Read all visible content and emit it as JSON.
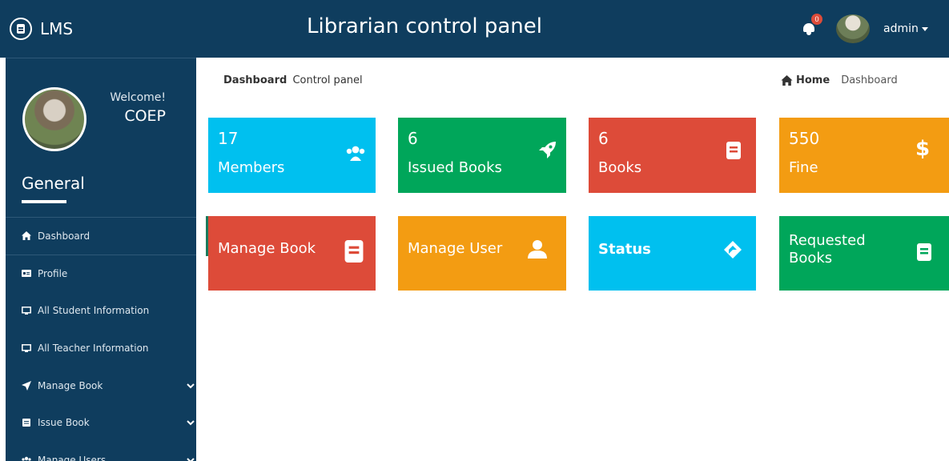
{
  "header": {
    "brand": "LMS",
    "title": "Librarian control panel",
    "notification_count": "0",
    "user": "admin"
  },
  "sidebar": {
    "welcome": "Welcome!",
    "username": "COEP",
    "section": "General",
    "items": [
      {
        "label": "Dashboard",
        "icon": "home-icon"
      },
      {
        "label": "Profile",
        "icon": "id-card-icon"
      },
      {
        "label": "All Student Information",
        "icon": "monitor-icon"
      },
      {
        "label": "All Teacher Information",
        "icon": "monitor-icon"
      },
      {
        "label": "Manage Book",
        "icon": "paper-plane-icon"
      },
      {
        "label": "Issue Book",
        "icon": "book-icon"
      },
      {
        "label": "Manage Users",
        "icon": "users-icon"
      }
    ]
  },
  "breadcrumb": {
    "page": "Dashboard",
    "subtitle": "Control panel",
    "home": "Home",
    "current": "Dashboard"
  },
  "tiles": [
    {
      "number": "17",
      "label": "Members",
      "icon": "users-icon",
      "color": "#00c0ef"
    },
    {
      "number": "6",
      "label": "Issued Books",
      "icon": "rocket-icon",
      "color": "#00a65a"
    },
    {
      "number": "6",
      "label": "Books",
      "icon": "book-icon",
      "color": "#dd4b39"
    },
    {
      "number": "550",
      "label": "Fine",
      "icon": "dollar-icon",
      "color": "#f39c12"
    }
  ],
  "action_tiles": [
    {
      "label": "Manage Book",
      "icon": "book-icon",
      "color": "#dd4b39"
    },
    {
      "label": "Manage User",
      "icon": "user-icon",
      "color": "#f39c12"
    },
    {
      "label": "Status",
      "icon": "layers-icon",
      "color": "#00c0ef"
    },
    {
      "label": "Requested Books",
      "icon": "book-icon",
      "color": "#00a65a"
    }
  ]
}
